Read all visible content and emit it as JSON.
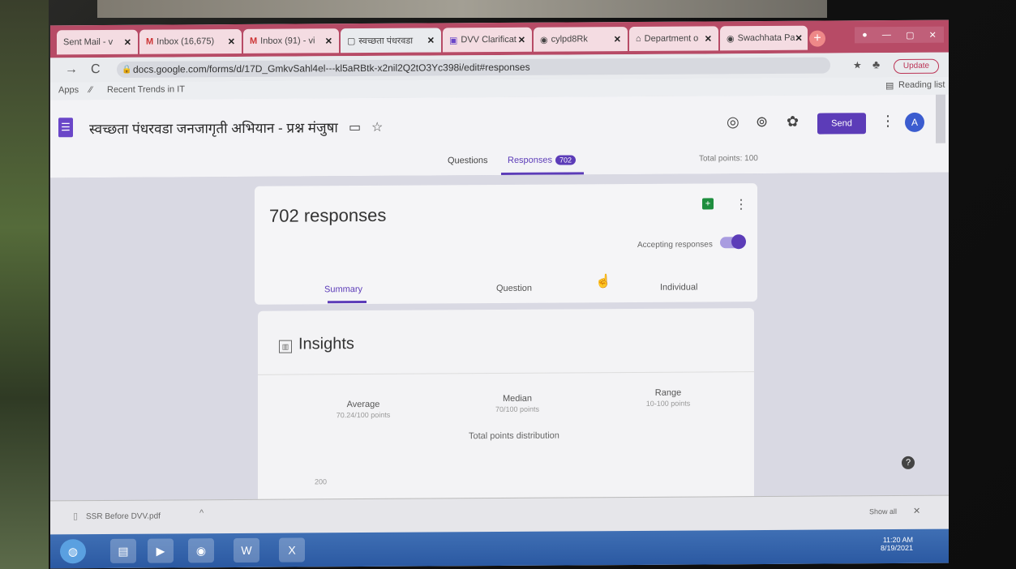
{
  "browser": {
    "tabs": [
      {
        "label": "Sent Mail - v",
        "icon": "mail-icon"
      },
      {
        "label": "Inbox (16,675)",
        "icon": "gmail-icon"
      },
      {
        "label": "Inbox (91) - vi",
        "icon": "gmail-icon"
      },
      {
        "label": "स्वच्छता पंधरवडा",
        "icon": "page-icon"
      },
      {
        "label": "DVV Clarificat",
        "icon": "forms-icon"
      },
      {
        "label": "cylpd8Rk",
        "icon": "chrome-icon"
      },
      {
        "label": "Department o",
        "icon": "building-icon"
      },
      {
        "label": "Swachhata Pa",
        "icon": "chrome-icon"
      }
    ],
    "url": "docs.google.com/forms/d/17D_GmkvSahl4el---kl5aRBtk-x2nil2Q2tO3Yc398i/edit#responses",
    "update_label": "Update",
    "bookmarks": {
      "apps": "Apps",
      "item1": "Recent Trends in IT",
      "reading_list": "Reading list"
    }
  },
  "form": {
    "title": "स्वच्छता पंधरवडा जनजागृती अभियान - प्रश्न मंजुषा",
    "send_label": "Send",
    "avatar_letter": "A",
    "nav": {
      "questions": "Questions",
      "responses": "Responses",
      "responses_count": "702",
      "total_points": "Total points: 100"
    }
  },
  "responses": {
    "count_title": "702 responses",
    "accepting_label": "Accepting responses",
    "accepting": true,
    "tabs": {
      "summary": "Summary",
      "question": "Question",
      "individual": "Individual"
    }
  },
  "insights": {
    "title": "Insights",
    "average": {
      "label": "Average",
      "value": "70.24/100 points"
    },
    "median": {
      "label": "Median",
      "value": "70/100 points"
    },
    "range": {
      "label": "Range",
      "value": "10-100 points"
    },
    "distribution_title": "Total points distribution",
    "axis_tick": "200"
  },
  "download": {
    "file": "SSR Before DVV.pdf",
    "show_all": "Show all"
  },
  "taskbar": {
    "time": "11:20 AM",
    "date": "8/19/2021"
  }
}
